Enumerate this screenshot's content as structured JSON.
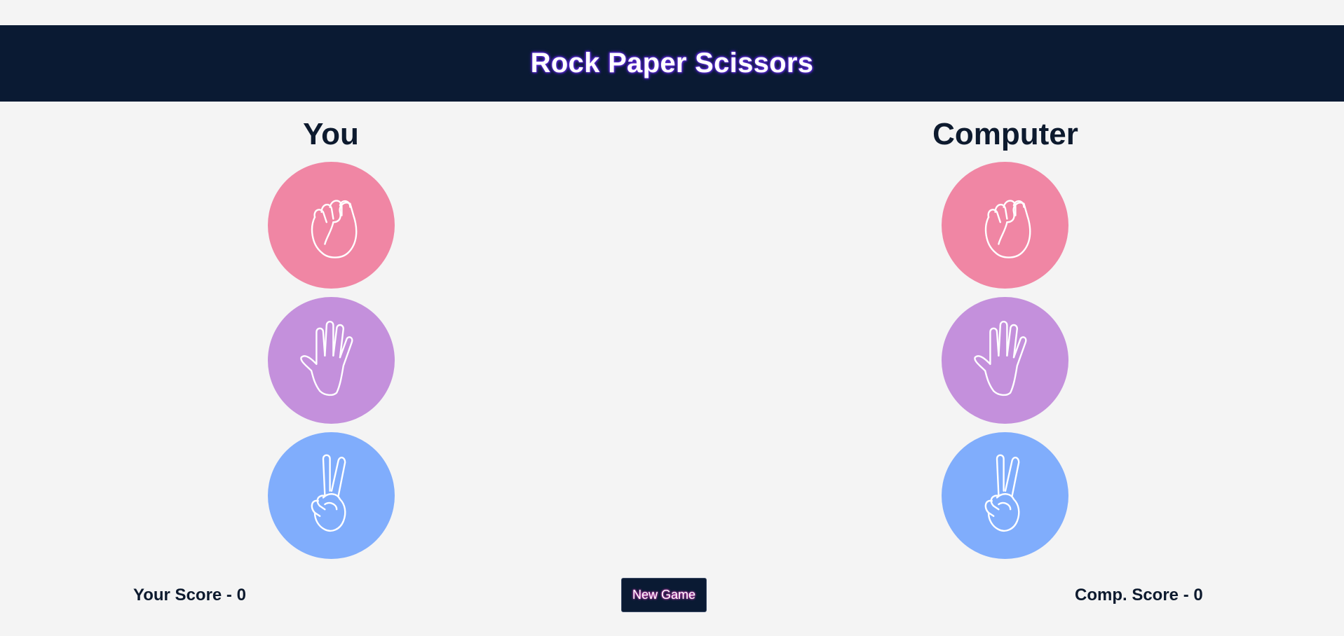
{
  "header": {
    "title": "Rock Paper Scissors"
  },
  "players": {
    "you": {
      "title": "You",
      "choices": [
        {
          "name": "rock",
          "icon": "fist-icon",
          "color": "#f086a4"
        },
        {
          "name": "paper",
          "icon": "open-hand-icon",
          "color": "#c490dc"
        },
        {
          "name": "scissors",
          "icon": "peace-hand-icon",
          "color": "#80adfc"
        }
      ]
    },
    "computer": {
      "title": "Computer",
      "choices": [
        {
          "name": "rock",
          "icon": "fist-icon",
          "color": "#f086a4"
        },
        {
          "name": "paper",
          "icon": "open-hand-icon",
          "color": "#c490dc"
        },
        {
          "name": "scissors",
          "icon": "peace-hand-icon",
          "color": "#80adfc"
        }
      ]
    }
  },
  "footer": {
    "your_score": "Your Score - 0",
    "new_game_label": "New Game",
    "comp_score": "Comp. Score - 0"
  },
  "colors": {
    "header_bg": "#0a1a33",
    "page_bg": "#f4f4f4",
    "rock": "#f086a4",
    "paper": "#c490dc",
    "scissors": "#80adfc"
  }
}
